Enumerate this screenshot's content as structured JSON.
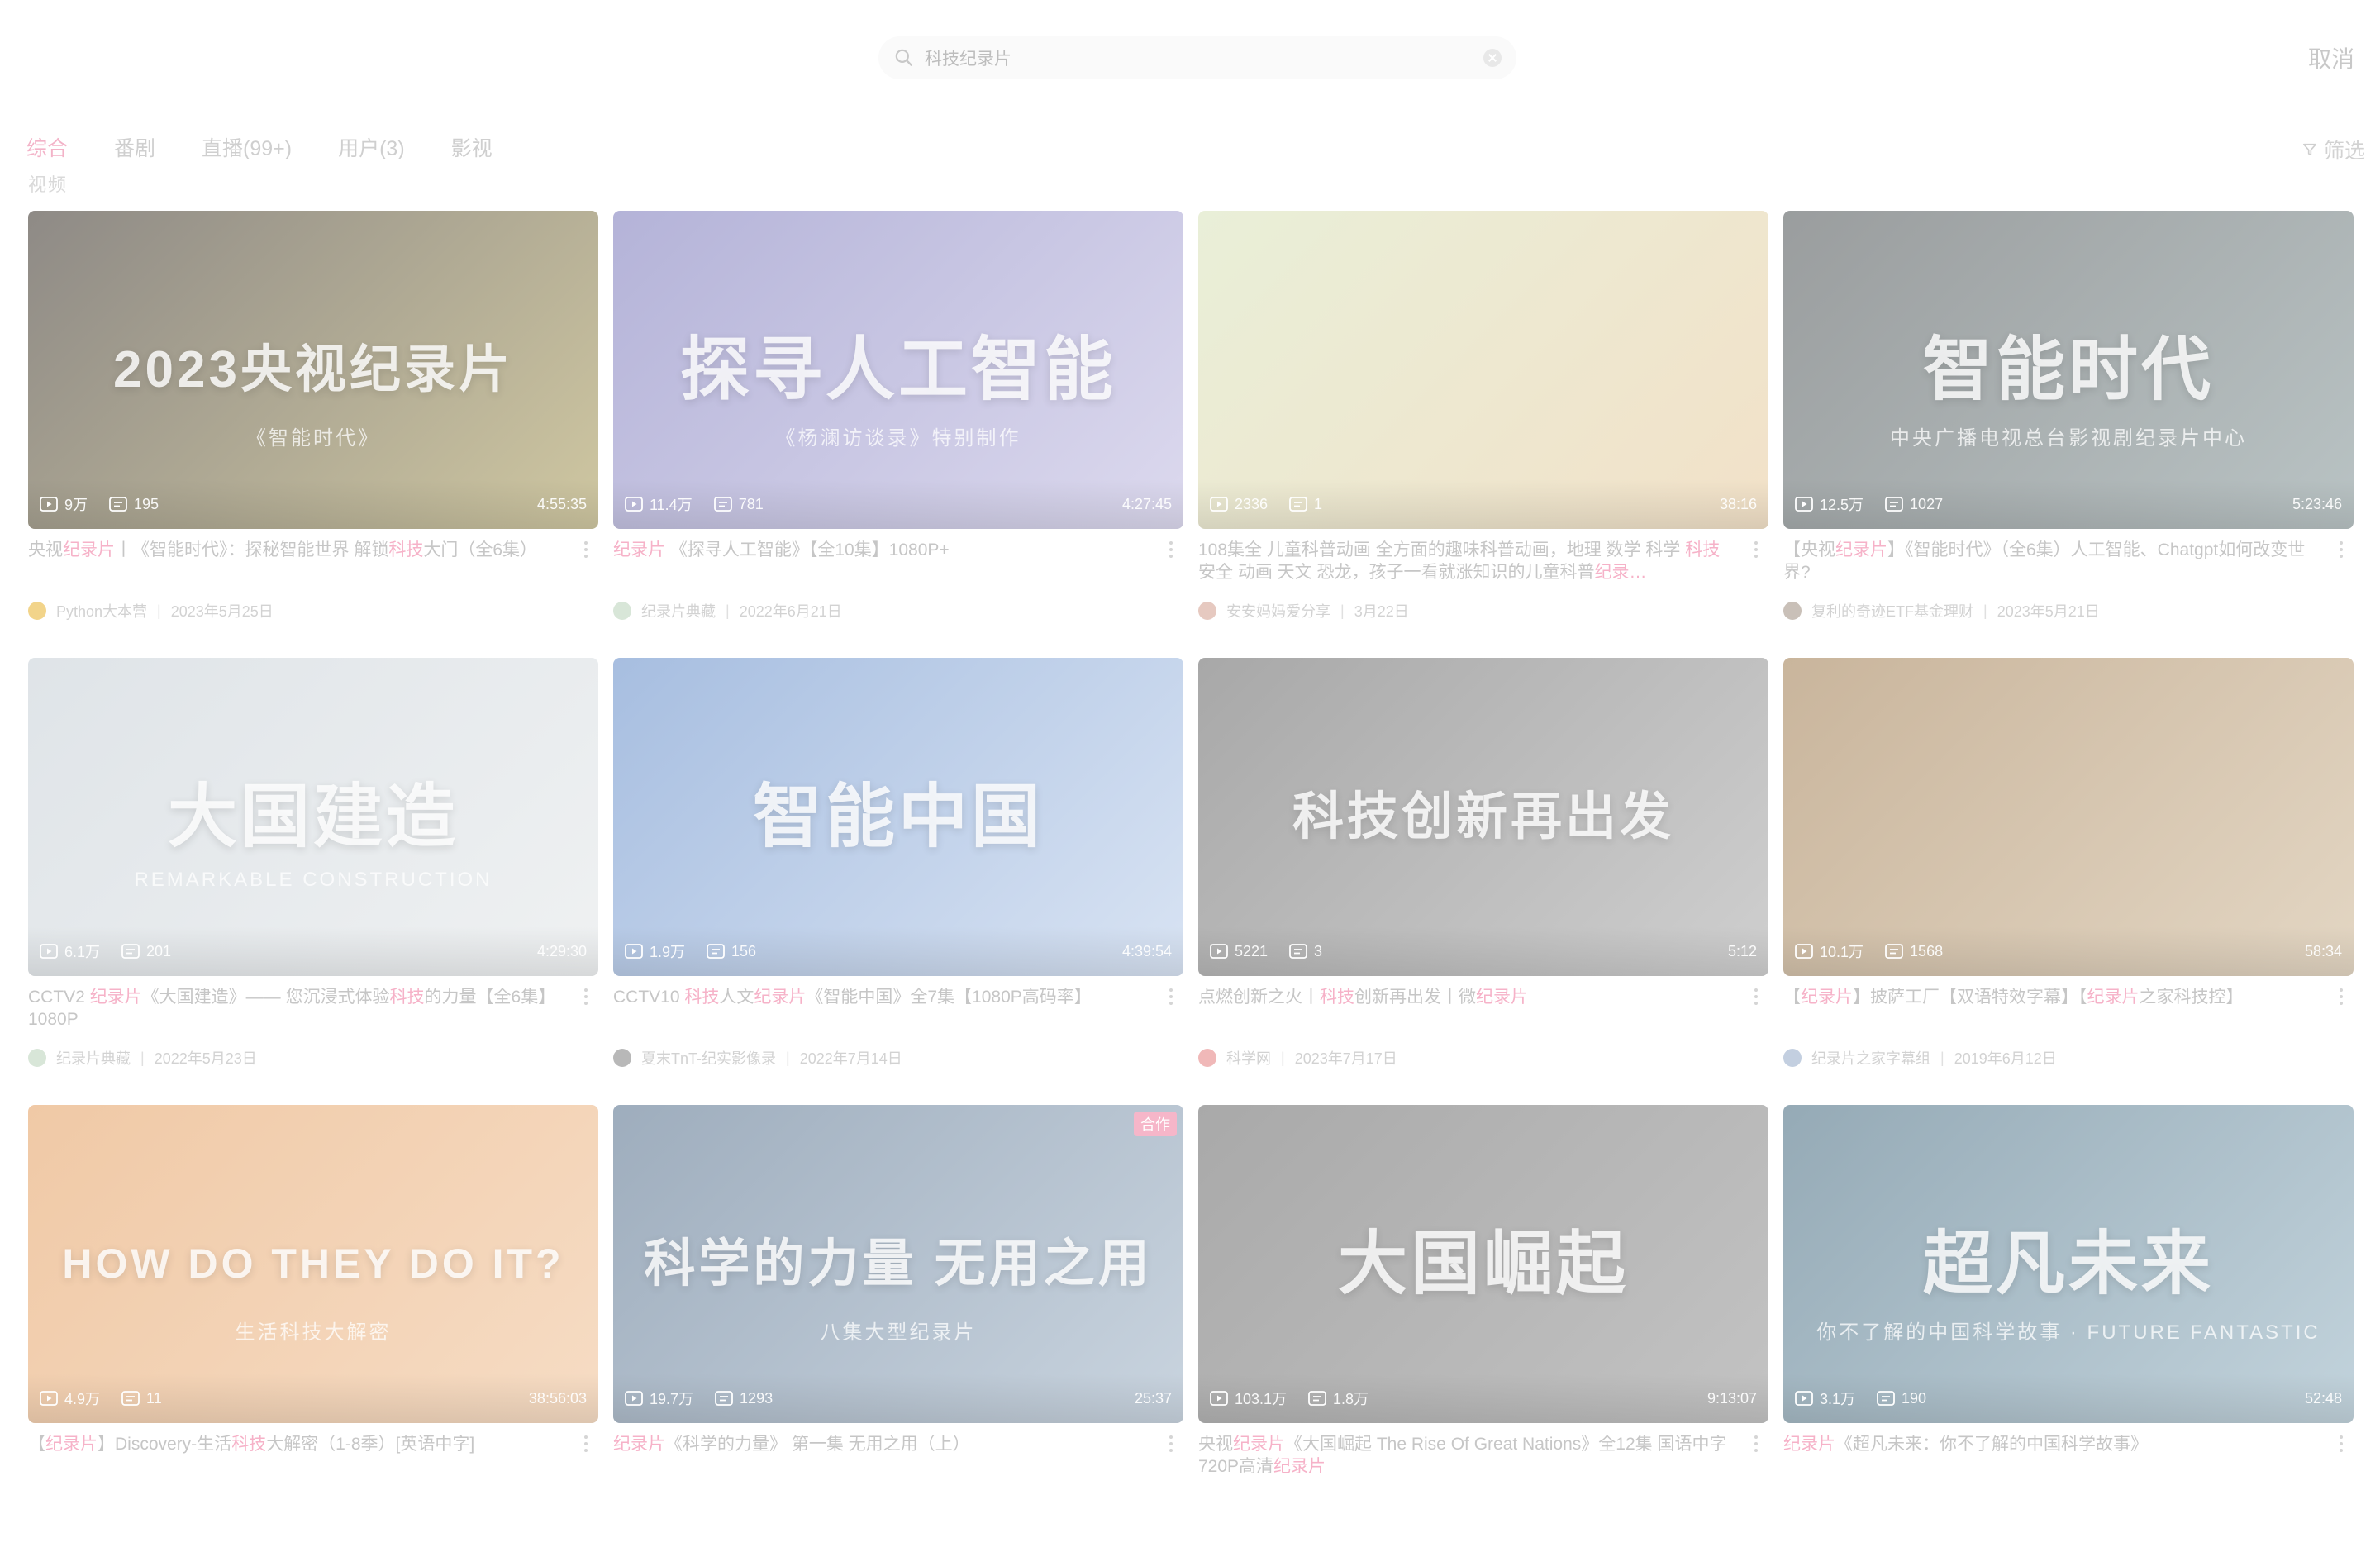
{
  "search": {
    "placeholder": "",
    "value": "科技纪录片",
    "cancel_label": "取消"
  },
  "tabs": [
    {
      "label": "综合",
      "active": true
    },
    {
      "label": "番剧",
      "active": false
    },
    {
      "label": "直播(99+)",
      "active": false
    },
    {
      "label": "用户(3)",
      "active": false
    },
    {
      "label": "影视",
      "active": false
    }
  ],
  "tab_peek": "视频",
  "filter_label": "筛选",
  "colors": {
    "accent": "#f3b3c8",
    "text": "#c6c6c6",
    "muted": "#d2d2d2"
  },
  "videos": [
    {
      "thumb_text": "2023央视纪录片",
      "thumb_sub": "《智能时代》",
      "thumb_bg": "#8e8a86",
      "thumb_bg2": "#cfc7a1",
      "views": "9万",
      "danmaku": "195",
      "duration": "4:55:35",
      "badge": "",
      "title_segments": [
        "央视",
        "纪录片",
        "丨《智能时代》：探秘智能世界 解锁",
        "科技",
        "大门（全6集）"
      ],
      "author": "Python大本营",
      "date": "2023年5月25日",
      "avatar_color": "#f2d48a"
    },
    {
      "thumb_text": "探寻人工智能",
      "thumb_sub": "《杨澜访谈录》特别制作",
      "thumb_bg": "#b4b3d8",
      "thumb_bg2": "#dcd9ee",
      "views": "11.4万",
      "danmaku": "781",
      "duration": "4:27:45",
      "badge": "",
      "title_segments": [
        "",
        "纪录片",
        " 《探寻人工智能》【全10集】1080P+",
        "",
        ""
      ],
      "author": "纪录片典藏",
      "date": "2022年6月21日",
      "avatar_color": "#d8e6d8"
    },
    {
      "thumb_text": "",
      "thumb_sub": "",
      "thumb_bg": "#e9efd8",
      "thumb_bg2": "#f2e1c8",
      "views": "2336",
      "danmaku": "1",
      "duration": "38:16",
      "badge": "",
      "title_segments": [
        "108集全 儿童科普动画 全方面的趣味科普动画，地理 数学 科学 ",
        "科技",
        " 安全 动画 天文 恐龙，孩子一看就涨知识的儿童科普",
        "纪录…",
        ""
      ],
      "author": "安安妈妈爱分享",
      "date": "3月22日",
      "avatar_color": "#e6c9c0"
    },
    {
      "thumb_text": "智能时代",
      "thumb_sub": "中央广播电视总台影视剧纪录片中心",
      "thumb_bg": "#9a9d9e",
      "thumb_bg2": "#b9c3c4",
      "views": "12.5万",
      "danmaku": "1027",
      "duration": "5:23:46",
      "badge": "",
      "title_segments": [
        "【央视",
        "纪录片",
        "】《智能时代》（全6集）人工智能、Chatgpt如何改变世界?",
        "",
        ""
      ],
      "author": "复利的奇迹ETF基金理财",
      "date": "2023年5月21日",
      "avatar_color": "#c9c0b8"
    },
    {
      "thumb_text": "大国建造",
      "thumb_sub": "REMARKABLE CONSTRUCTION",
      "thumb_bg": "#dfe4e8",
      "thumb_bg2": "#eff1f2",
      "views": "6.1万",
      "danmaku": "201",
      "duration": "4:29:30",
      "badge": "",
      "title_segments": [
        "CCTV2 ",
        "纪录片",
        "《大国建造》—— 您沉浸式体验",
        "科技",
        "的力量【全6集】1080P"
      ],
      "author": "纪录片典藏",
      "date": "2022年5月23日",
      "avatar_color": "#d8e6d8"
    },
    {
      "thumb_text": "智能中国",
      "thumb_sub": "",
      "thumb_bg": "#a7bee0",
      "thumb_bg2": "#d8e3f3",
      "views": "1.9万",
      "danmaku": "156",
      "duration": "4:39:54",
      "badge": "",
      "title_segments": [
        "CCTV10 ",
        "科技",
        "人文",
        "纪录片",
        "《智能中国》全7集【1080P高码率】"
      ],
      "author": "夏末TnT-纪实影像录",
      "date": "2022年7月14日",
      "avatar_color": "#b8b8b8"
    },
    {
      "thumb_text": "科技创新再出发",
      "thumb_sub": "",
      "thumb_bg": "#a8a8a8",
      "thumb_bg2": "#cfcfcf",
      "views": "5221",
      "danmaku": "3",
      "duration": "5:12",
      "badge": "",
      "title_segments": [
        "点燃创新之火丨",
        "科技",
        "创新再出发丨微",
        "纪录片",
        ""
      ],
      "author": "科学网",
      "date": "2023年7月17日",
      "avatar_color": "#f0b8b8"
    },
    {
      "thumb_text": "",
      "thumb_sub": "",
      "thumb_bg": "#c9b59c",
      "thumb_bg2": "#e3d6c3",
      "views": "10.1万",
      "danmaku": "1568",
      "duration": "58:34",
      "badge": "",
      "title_segments": [
        "【",
        "纪录片",
        "】披萨工厂【双语特效字幕】【",
        "纪录片",
        "之家科技控】"
      ],
      "author": "纪录片之家字幕组",
      "date": "2019年6月12日",
      "avatar_color": "#c3cfe0"
    },
    {
      "thumb_text": "HOW DO THEY DO IT?",
      "thumb_sub": "生活科技大解密",
      "thumb_bg": "#f0c9a6",
      "thumb_bg2": "#f6dcc4",
      "views": "4.9万",
      "danmaku": "11",
      "duration": "38:56:03",
      "badge": "",
      "title_segments": [
        "【",
        "纪录片",
        "】Discovery-生活",
        "科技",
        "大解密（1-8季）[英语中字]"
      ],
      "author": "",
      "date": "",
      "avatar_color": "#dddddd"
    },
    {
      "thumb_text": "科学的力量 无用之用",
      "thumb_sub": "八集大型纪录片",
      "thumb_bg": "#9eadbd",
      "thumb_bg2": "#c9d4df",
      "views": "19.7万",
      "danmaku": "1293",
      "duration": "25:37",
      "badge": "合作",
      "title_segments": [
        "",
        "纪录片",
        "《科学的力量》 第一集 无用之用（上）",
        "",
        ""
      ],
      "author": "",
      "date": "",
      "avatar_color": "#dddddd"
    },
    {
      "thumb_text": "大国崛起",
      "thumb_sub": "",
      "thumb_bg": "#a9a9a9",
      "thumb_bg2": "#c3c3c3",
      "views": "103.1万",
      "danmaku": "1.8万",
      "duration": "9:13:07",
      "badge": "",
      "title_segments": [
        "央视",
        "纪录片",
        "《大国崛起 The Rise Of Great Nations》全12集 国语中字720P高清",
        "纪录片",
        ""
      ],
      "author": "",
      "date": "",
      "avatar_color": "#dddddd"
    },
    {
      "thumb_text": "超凡未来",
      "thumb_sub": "你不了解的中国科学故事 · FUTURE FANTASTIC",
      "thumb_bg": "#95aab6",
      "thumb_bg2": "#c2d3dc",
      "views": "3.1万",
      "danmaku": "190",
      "duration": "52:48",
      "badge": "",
      "title_segments": [
        "",
        "纪录片",
        "《超凡未来：你不了解的中国科学故事》",
        "",
        ""
      ],
      "author": "",
      "date": "",
      "avatar_color": "#dddddd"
    }
  ]
}
